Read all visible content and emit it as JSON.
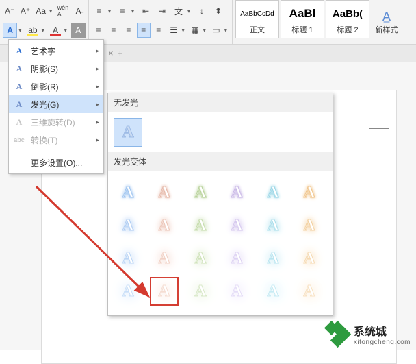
{
  "ribbon": {
    "styles": [
      {
        "preview": "AaBbCcDd",
        "label": "正文",
        "bold": false
      },
      {
        "preview": "AaBl",
        "label": "标题 1",
        "bold": true
      },
      {
        "preview": "AaBb(",
        "label": "标题 2",
        "bold": true
      }
    ],
    "new_style": "新样式"
  },
  "tabstrip": {
    "close": "×",
    "plus": "+"
  },
  "menu": {
    "items": [
      {
        "icon": "A",
        "label": "艺术字",
        "arrow": true,
        "disabled": false,
        "hov": false
      },
      {
        "icon": "A",
        "label": "阴影(S)",
        "arrow": true,
        "disabled": false,
        "hov": false
      },
      {
        "icon": "A",
        "label": "倒影(R)",
        "arrow": true,
        "disabled": false,
        "hov": false
      },
      {
        "icon": "A",
        "label": "发光(G)",
        "arrow": true,
        "disabled": false,
        "hov": true
      },
      {
        "icon": "A",
        "label": "三维旋转(D)",
        "arrow": true,
        "disabled": true,
        "hov": false
      },
      {
        "icon": "abc",
        "label": "转换(T)",
        "arrow": true,
        "disabled": true,
        "hov": false
      }
    ],
    "more": "更多设置(O)..."
  },
  "flyout": {
    "no_glow": "无发光",
    "variants": "发光变体",
    "rows": 4,
    "cols": 6,
    "highlight": {
      "row": 3,
      "col": 1
    },
    "colors": [
      [
        "#9ec4f0",
        "#e6b8a8",
        "#b8d29a",
        "#c9b8e6",
        "#9ad6e6",
        "#f0c48a"
      ],
      [
        "#aeccf3",
        "#ecc5b7",
        "#c5dcab",
        "#d4c6ee",
        "#aadeeb",
        "#f3d09f"
      ],
      [
        "#bcd6f6",
        "#f1d1c5",
        "#d0e3bb",
        "#ddd2f3",
        "#b9e5f0",
        "#f6dab2"
      ],
      [
        "#c9dff8",
        "#f5ddd2",
        "#dae9ca",
        "#e5ddf7",
        "#c7ebf4",
        "#f8e2c3"
      ]
    ]
  },
  "watermark": {
    "brand": "系统城",
    "domain": "xitongcheng.com"
  }
}
